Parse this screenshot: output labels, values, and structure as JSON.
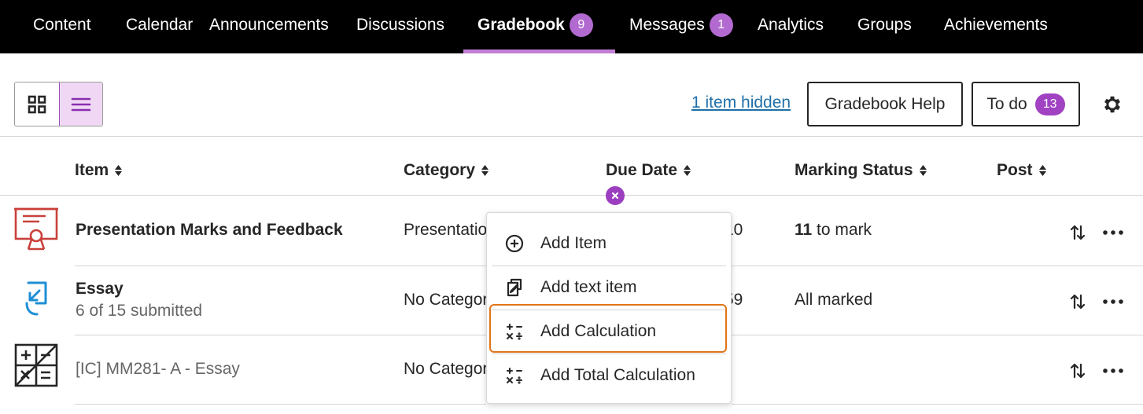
{
  "nav": {
    "items": [
      {
        "label": "Content"
      },
      {
        "label": "Calendar"
      },
      {
        "label": "Announcements"
      },
      {
        "label": "Discussions"
      },
      {
        "label": "Gradebook",
        "badge": "9",
        "active": true
      },
      {
        "label": "Messages",
        "badge": "1"
      },
      {
        "label": "Analytics"
      },
      {
        "label": "Groups"
      },
      {
        "label": "Achievements"
      }
    ]
  },
  "toolbar": {
    "grid_view_icon": "grid-icon",
    "list_view_icon": "list-icon",
    "hidden_link": "1 item hidden",
    "help_button": "Gradebook Help",
    "todo_label": "To do",
    "todo_count": "13",
    "settings_icon": "gear-icon"
  },
  "table": {
    "columns": [
      "Item",
      "Category",
      "Due Date",
      "Marking Status",
      "Post"
    ],
    "rows": [
      {
        "icon": "presentation-icon",
        "title": "Presentation Marks and Feedback",
        "category": "Presentatio",
        "due": "10",
        "status_count": "11",
        "status_text": "to mark"
      },
      {
        "icon": "assignment-icon",
        "title": "Essay",
        "subtitle": "6 of 15 submitted",
        "category": "No Categor",
        "due": "59",
        "status_text": "All marked"
      },
      {
        "icon": "calculation-icon",
        "title": "[IC] MM281- A - Essay",
        "category": "No Categor"
      }
    ]
  },
  "menu": {
    "items": [
      {
        "label": "Add Item",
        "icon": "plus-circle-icon"
      },
      {
        "label": "Add text item",
        "icon": "text-item-icon"
      },
      {
        "label": "Add Calculation",
        "icon": "calculation-icon"
      },
      {
        "label": "Add Total Calculation",
        "icon": "calculation-icon"
      }
    ]
  },
  "colors": {
    "accent": "#a042c2",
    "highlight": "#e07418",
    "link": "#1f6fa8",
    "presentation_icon": "#c9403a",
    "assignment_icon": "#1e8fd6"
  }
}
